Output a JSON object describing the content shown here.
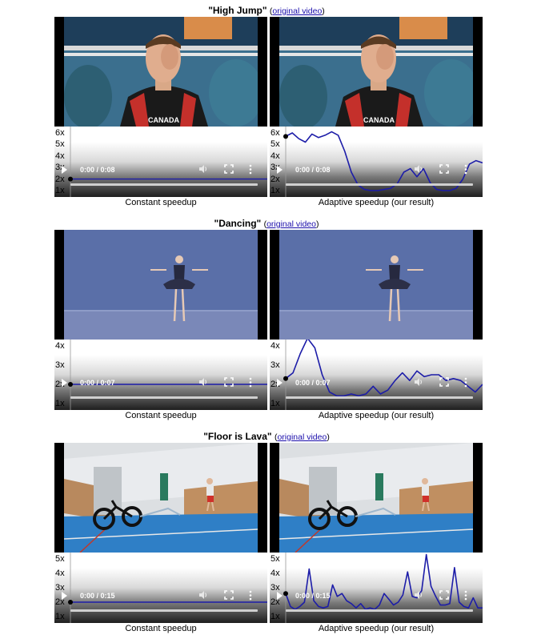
{
  "sections": [
    {
      "title": "\"High Jump\"",
      "link_text": "original video",
      "left": {
        "caption": "Constant speedup",
        "time": "0:00 / 0:08",
        "curve": "constant"
      },
      "right": {
        "caption": "Adaptive speedup (our result)",
        "time": "0:00 / 0:08",
        "curve": "adaptive"
      },
      "yticks": [
        "6x",
        "5x",
        "4x",
        "3x",
        "2x",
        "1x"
      ],
      "constant_speedup": 2.0,
      "adaptive_speedup": [
        5.7,
        6.0,
        5.5,
        5.2,
        5.9,
        5.6,
        5.8,
        6.1,
        5.8,
        4.4,
        2.6,
        1.5,
        1.1,
        1.0,
        1.0,
        1.1,
        1.2,
        1.6,
        2.6,
        2.9,
        2.2,
        2.9,
        1.7,
        1.1,
        1.0,
        1.0,
        1.2,
        2.0,
        3.3,
        3.6,
        3.4
      ]
    },
    {
      "title": "\"Dancing\"",
      "link_text": "original video",
      "left": {
        "caption": "Constant speedup",
        "time": "0:00 / 0:07",
        "curve": "constant"
      },
      "right": {
        "caption": "Adaptive speedup (our result)",
        "time": "0:00 / 0:07",
        "curve": "adaptive"
      },
      "yticks": [
        "4x",
        "3x",
        "2x",
        "1x"
      ],
      "constant_speedup": 2.0,
      "adaptive_speedup": [
        2.3,
        2.6,
        3.6,
        4.4,
        3.9,
        2.5,
        1.6,
        1.4,
        1.4,
        1.5,
        1.4,
        1.5,
        1.9,
        1.5,
        1.7,
        2.2,
        2.6,
        2.2,
        2.7,
        2.4,
        2.5,
        2.5,
        2.2,
        2.3,
        2.2,
        1.9,
        1.6,
        2.0
      ]
    },
    {
      "title": "\"Floor is Lava\"",
      "link_text": "original video",
      "left": {
        "caption": "Constant speedup",
        "time": "0:00 / 0:15",
        "curve": "constant"
      },
      "right": {
        "caption": "Adaptive speedup (our result)",
        "time": "0:00 / 0:15",
        "curve": "adaptive"
      },
      "yticks": [
        "5x",
        "4x",
        "3x",
        "2x",
        "1x"
      ],
      "constant_speedup": 2.0,
      "adaptive_speedup": [
        2.6,
        1.7,
        1.5,
        1.7,
        2.0,
        4.3,
        2.1,
        1.7,
        1.6,
        1.7,
        3.2,
        2.4,
        2.6,
        2.1,
        1.9,
        1.6,
        1.9,
        1.5,
        1.6,
        1.5,
        1.8,
        2.6,
        2.2,
        1.8,
        2.0,
        2.5,
        4.1,
        2.4,
        2.3,
        2.8,
        5.3,
        3.1,
        2.4,
        1.8,
        1.8,
        1.9,
        4.4,
        2.0,
        1.7,
        1.6,
        2.3,
        1.6,
        1.6
      ]
    }
  ],
  "colors": {
    "curve": "#1c1ca8",
    "link": "#1a0dab",
    "panel_bg": "#000000"
  },
  "icons": [
    "play-icon",
    "volume-icon",
    "fullscreen-icon",
    "more-options-icon"
  ]
}
